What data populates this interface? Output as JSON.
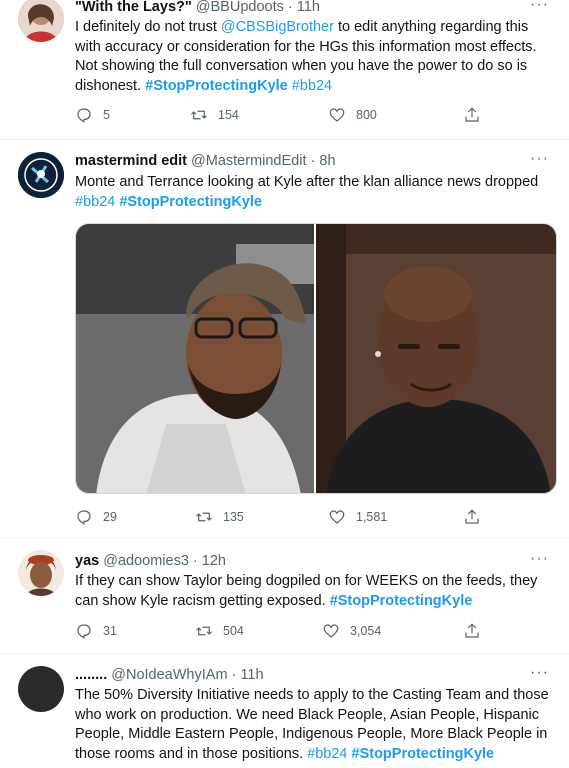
{
  "tweets": [
    {
      "name": "\"With the Lays?\"",
      "handle": "@BBUpdoots",
      "dot": "·",
      "time": "11h",
      "more": "···",
      "text": {
        "t1": "I definitely do not trust ",
        "mention": "@CBSBigBrother",
        "t2": " to edit anything regarding this with accuracy or consideration for the HGs this information most effects. Not showing the full conversation when you have the power to do so is dishonest. ",
        "tag1": "#StopProtectingKyle",
        "tag2": "#bb24"
      },
      "replies": "5",
      "retweets": "154",
      "likes": "800"
    },
    {
      "name": "mastermind edit",
      "handle": "@MastermindEdit",
      "dot": "·",
      "time": "8h",
      "more": "···",
      "text": {
        "t1": "Monte and Terrance looking at Kyle after the klan alliance news dropped",
        "tag1": "#bb24",
        "tag2": "#StopProtectingKyle"
      },
      "replies": "29",
      "retweets": "135",
      "likes": "1,581"
    },
    {
      "name": "yas",
      "handle": "@adoomies3",
      "dot": "·",
      "time": "12h",
      "more": "···",
      "text": {
        "t1": "If they can show Taylor being dogpiled on for WEEKS on the feeds, they can show Kyle racism getting exposed. ",
        "tag1": "#StopProtectingKyle"
      },
      "replies": "31",
      "retweets": "504",
      "likes": "3,054"
    },
    {
      "name": "........",
      "handle": "@NoIdeaWhyIAm",
      "dot": "·",
      "time": "11h",
      "more": "···",
      "text": {
        "t1": "The 50% Diversity Initiative needs to apply to the Casting Team and those who work on production. We need Black People, Asian People, Hispanic People, Middle Eastern People, Indigenous People, More Black People in those rooms and in those positions. ",
        "tag1": "#bb24",
        "tag2": "#StopProtectingKyle"
      }
    }
  ],
  "icons": {
    "reply": "reply-icon",
    "retweet": "retweet-icon",
    "like": "heart-icon",
    "share": "share-icon",
    "more": "more-icon"
  },
  "colors": {
    "accent": "#1d9bf0",
    "secondary_text": "#536471",
    "divider": "#eff3f4"
  }
}
